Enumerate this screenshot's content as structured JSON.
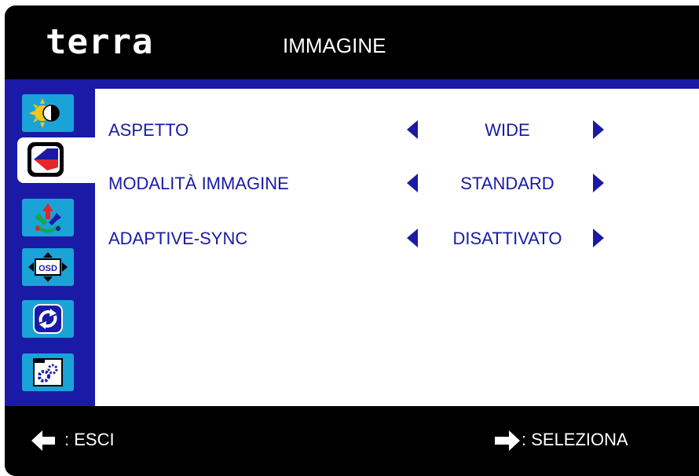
{
  "header": {
    "logo": "terra",
    "title": "IMMAGINE"
  },
  "sidebar": {
    "items": [
      {
        "name": "brightness-contrast",
        "icon": "sun-contrast-icon"
      },
      {
        "name": "image",
        "icon": "image-setup-icon",
        "selected": true
      },
      {
        "name": "color",
        "icon": "color-icon"
      },
      {
        "name": "osd-settings",
        "icon": "osd-icon",
        "label": "OSD"
      },
      {
        "name": "reset",
        "icon": "reset-icon"
      },
      {
        "name": "extra",
        "icon": "gears-icon"
      }
    ]
  },
  "menu": {
    "rows": [
      {
        "label": "ASPETTO",
        "value": "WIDE"
      },
      {
        "label": "MODALITÀ IMMAGINE",
        "value": "STANDARD"
      },
      {
        "label": "ADAPTIVE-SYNC",
        "value": "DISATTIVATO"
      }
    ]
  },
  "footer": {
    "exit": ": ESCI",
    "select": ": SELEZIONA"
  },
  "colors": {
    "accent": "#1a1aa6",
    "tile": "#1aa3d6",
    "background": "#000000"
  }
}
